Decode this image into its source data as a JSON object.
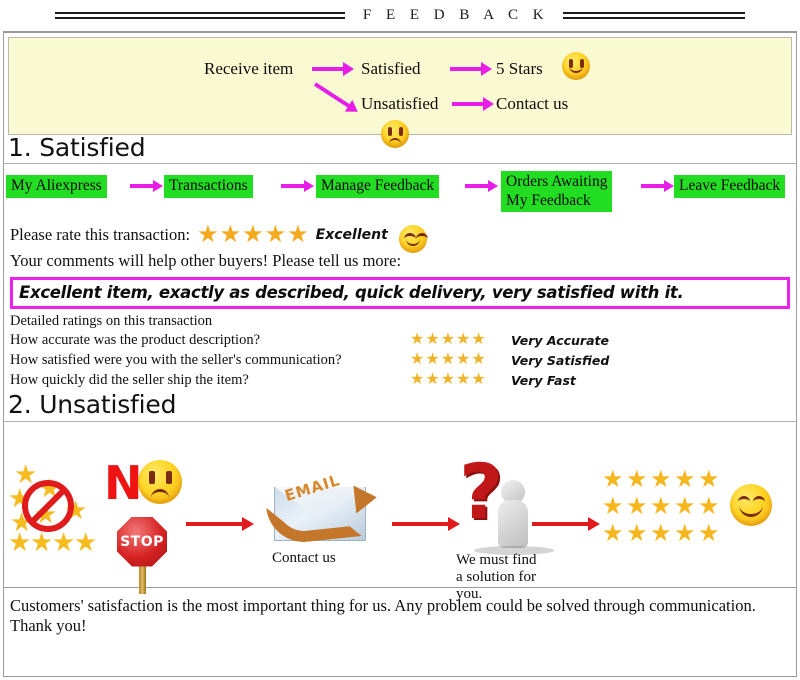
{
  "header": {
    "title": "F E E D B A C K"
  },
  "banner": {
    "receive_item": "Receive item",
    "satisfied": "Satisfied",
    "five_stars": "5 Stars",
    "unsatisfied": "Unsatisfied",
    "contact_us": "Contact us",
    "happy_face_icon": "happy-face-icon",
    "sad_face_icon": "sad-face-icon",
    "arrow_color": "#e81ee8"
  },
  "section1": {
    "title": "1. Satisfied",
    "crumbs": [
      {
        "label": "My Aliexpress"
      },
      {
        "label": "Transactions"
      },
      {
        "label": "Manage Feedback"
      },
      {
        "label": "Orders Awaiting\nMy Feedback"
      },
      {
        "label": "Leave Feedback"
      }
    ],
    "crumb_color": "#22dd22",
    "rate_prompt": "Please rate this transaction:",
    "rate_stars": 5,
    "rate_value": "Excellent",
    "comments_prompt": "Your comments will help other buyers! Please tell us more:",
    "comment_text": "Excellent item, exactly as described, quick delivery, very satisfied with it.",
    "comment_border_color": "#ee22ee",
    "detail_heading": "Detailed ratings on this transaction",
    "detail_rows": [
      {
        "question": "How accurate was the product description?",
        "stars": 5,
        "value": "Very Accurate"
      },
      {
        "question": "How satisfied were you with the seller's communication?",
        "stars": 5,
        "value": "Very Satisfied"
      },
      {
        "question": "How quickly did the seller ship the item?",
        "stars": 5,
        "value": "Very Fast"
      }
    ]
  },
  "section2": {
    "title": "2. Unsatisfied",
    "no_letter": "N",
    "stop_label": "STOP",
    "email_label": "EMAIL",
    "contact_caption": "Contact us",
    "solution_caption": "We must find\na solution for\nyou.",
    "arrow_color": "#e01b1b",
    "star_color": "#f5b61e",
    "grid_rows": 3,
    "grid_cols": 5,
    "crossed_stars_icon": "no-stars-icon",
    "sad_face_icon": "sad-face-icon",
    "happy_face_icon": "happy-face-icon",
    "question_mark_icon": "question-mark-icon",
    "envelope_icon": "envelope-icon",
    "stop_sign_icon": "stop-sign-icon"
  },
  "footer": {
    "text": "Customers' satisfaction is the most important thing for us. Any problem could be solved through communication. Thank you!"
  }
}
